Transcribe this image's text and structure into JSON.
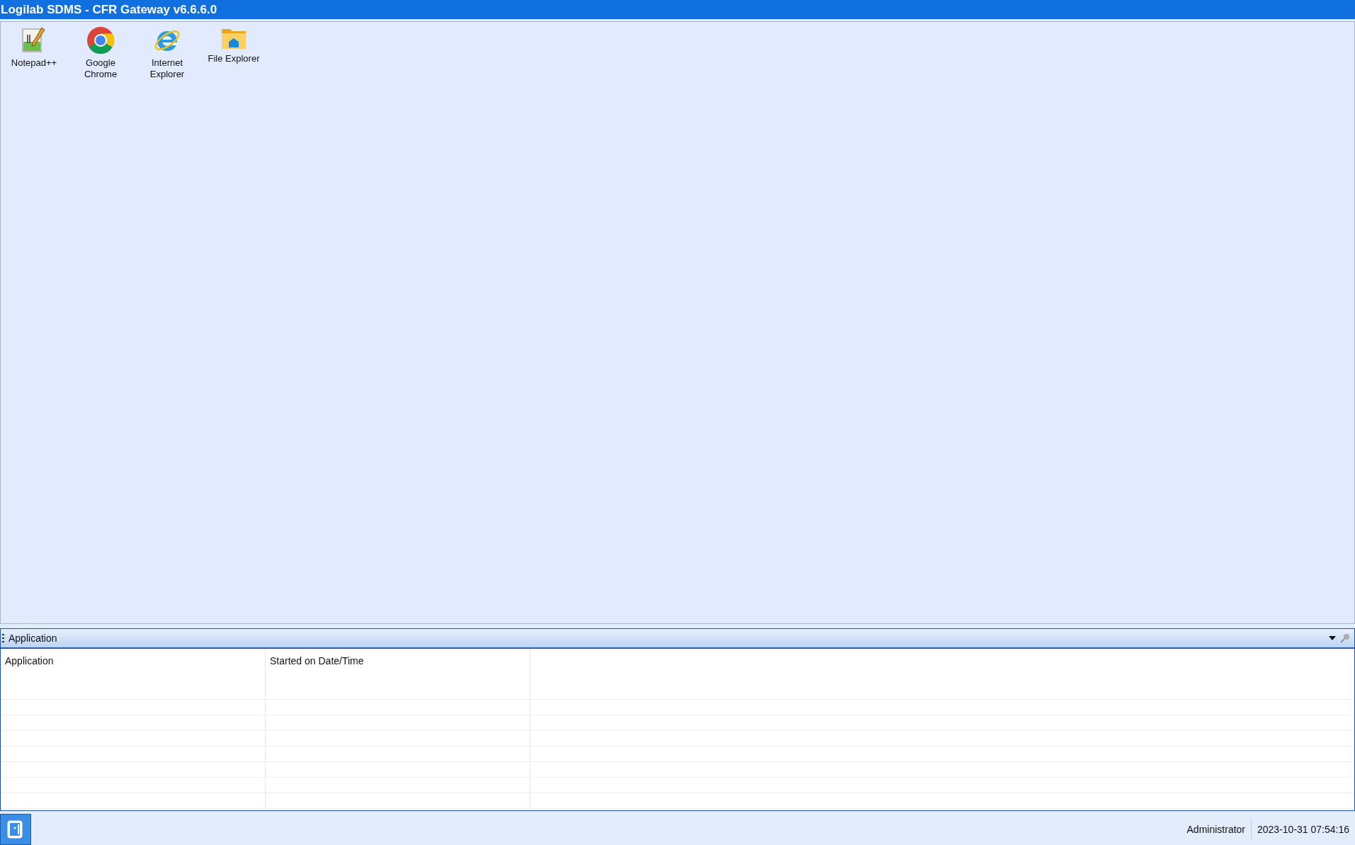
{
  "window": {
    "title": "Logilab SDMS - CFR Gateway v6.6.6.0"
  },
  "desktop_icons": [
    {
      "label": "Notepad++",
      "kind": "notepad"
    },
    {
      "label": "Google Chrome",
      "kind": "chrome"
    },
    {
      "label": "Internet Explorer",
      "kind": "ie"
    },
    {
      "label": "File Explorer",
      "kind": "folder"
    }
  ],
  "panel": {
    "title": "Application",
    "columns": [
      "Application",
      "Started on Date/Time"
    ]
  },
  "status_bar": {
    "user": "Administrator",
    "datetime": "2023-10-31 07:54:16"
  }
}
